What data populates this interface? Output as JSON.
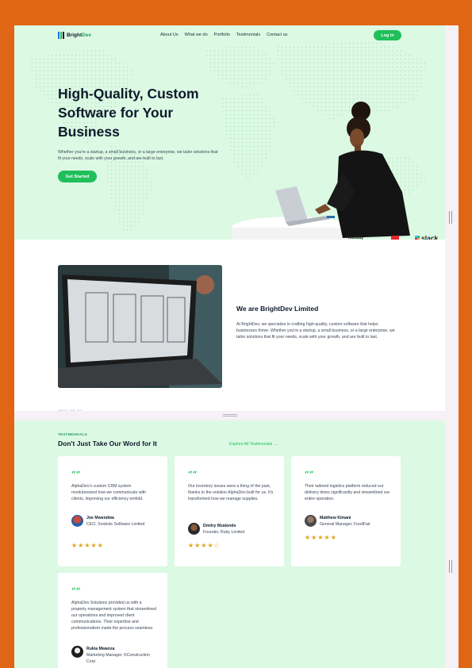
{
  "nav": {
    "brand_prefix": "Bright",
    "brand_suffix": "Dev",
    "links": [
      "About Us",
      "What we do",
      "Portfolio",
      "Testimonials",
      "Contact us"
    ],
    "login": "Log in"
  },
  "hero": {
    "title": "High-Quality, Custom Software for Your Business",
    "subtitle": "Whether you're a startup, a small business, or a large enterprise, we tailor solutions that fit your needs, scale with your growth, and are built to last.",
    "cta": "Get Started",
    "partners": {
      "monday": "monday",
      "slack": "slack"
    }
  },
  "about": {
    "title": "We are BrightDev Limited",
    "text": "At BrightDev, we specialize in crafting high-quality, custom software that helps businesses thrive. Whether you're a startup, a small business, or a large enterprise, we tailor solutions that fit your needs, scale with your growth, and are built to last.",
    "cut_label": "WHAT WE DO"
  },
  "testimonials": {
    "eyebrow": "TESTIMONIALS",
    "title": "Don't Just Take Our Word for It",
    "explore": "Explore All Testimonials →",
    "quote_mark": "““",
    "items": [
      {
        "text": "AlphaDev's custom CRM system revolutionized how we communicate with clients, improving our efficiency tenfold.",
        "name": "Joe Mwendwa",
        "role": "CEO, Snobole Software Limited",
        "stars": "★★★★★"
      },
      {
        "text": "Our inventory issues were a thing of the past, thanks to the solution AlphaDev built for us. It's transformed how we manage supplies.",
        "name": "Dmitry Mzalendo",
        "role": "Founder, Ruby Limited",
        "stars": "★★★★☆"
      },
      {
        "text": "Their tailored logistics platform reduced our delivery times significantly and streamlined our entire operation.",
        "name": "Matthew Kimani",
        "role": "General Manager, FoodFair",
        "stars": "★★★★★"
      },
      {
        "text": "AlphaDev Solutions provided us with a property management system that streamlined our operations and improved client communications. Their expertise and professionalism made the process seamless.",
        "name": "Rukia Mwanza",
        "role": "Marketing Manager, KConstruction Corp",
        "stars": ""
      }
    ]
  },
  "colors": {
    "accent": "#1fbf5a",
    "hero_bg": "#dcf9e4",
    "page_bg": "#e06514",
    "star": "#e3a21a"
  }
}
